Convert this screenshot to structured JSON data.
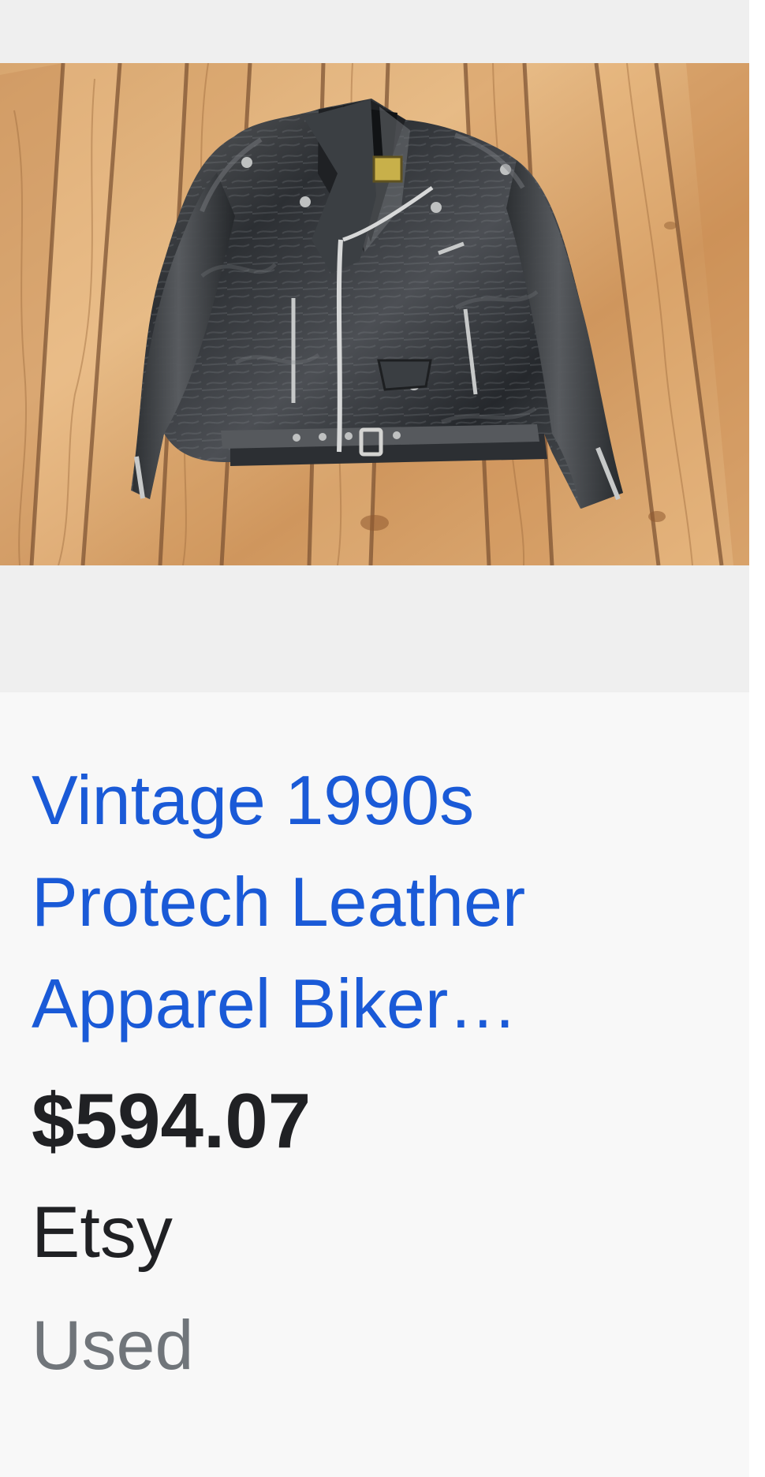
{
  "product": {
    "image_icon": "black-leather-biker-jacket-on-wooden-deck",
    "title_lines": [
      "Vintage 1990s",
      "Protech Leather",
      "Apparel Biker…"
    ],
    "price": "$594.07",
    "merchant": "Etsy",
    "condition": "Used"
  },
  "colors": {
    "title_link": "#1a5ad7",
    "price_text": "#202124",
    "merchant_text": "#202124",
    "condition_text": "#70757a",
    "card_background": "#f8f8f8",
    "image_background": "#efefef"
  }
}
